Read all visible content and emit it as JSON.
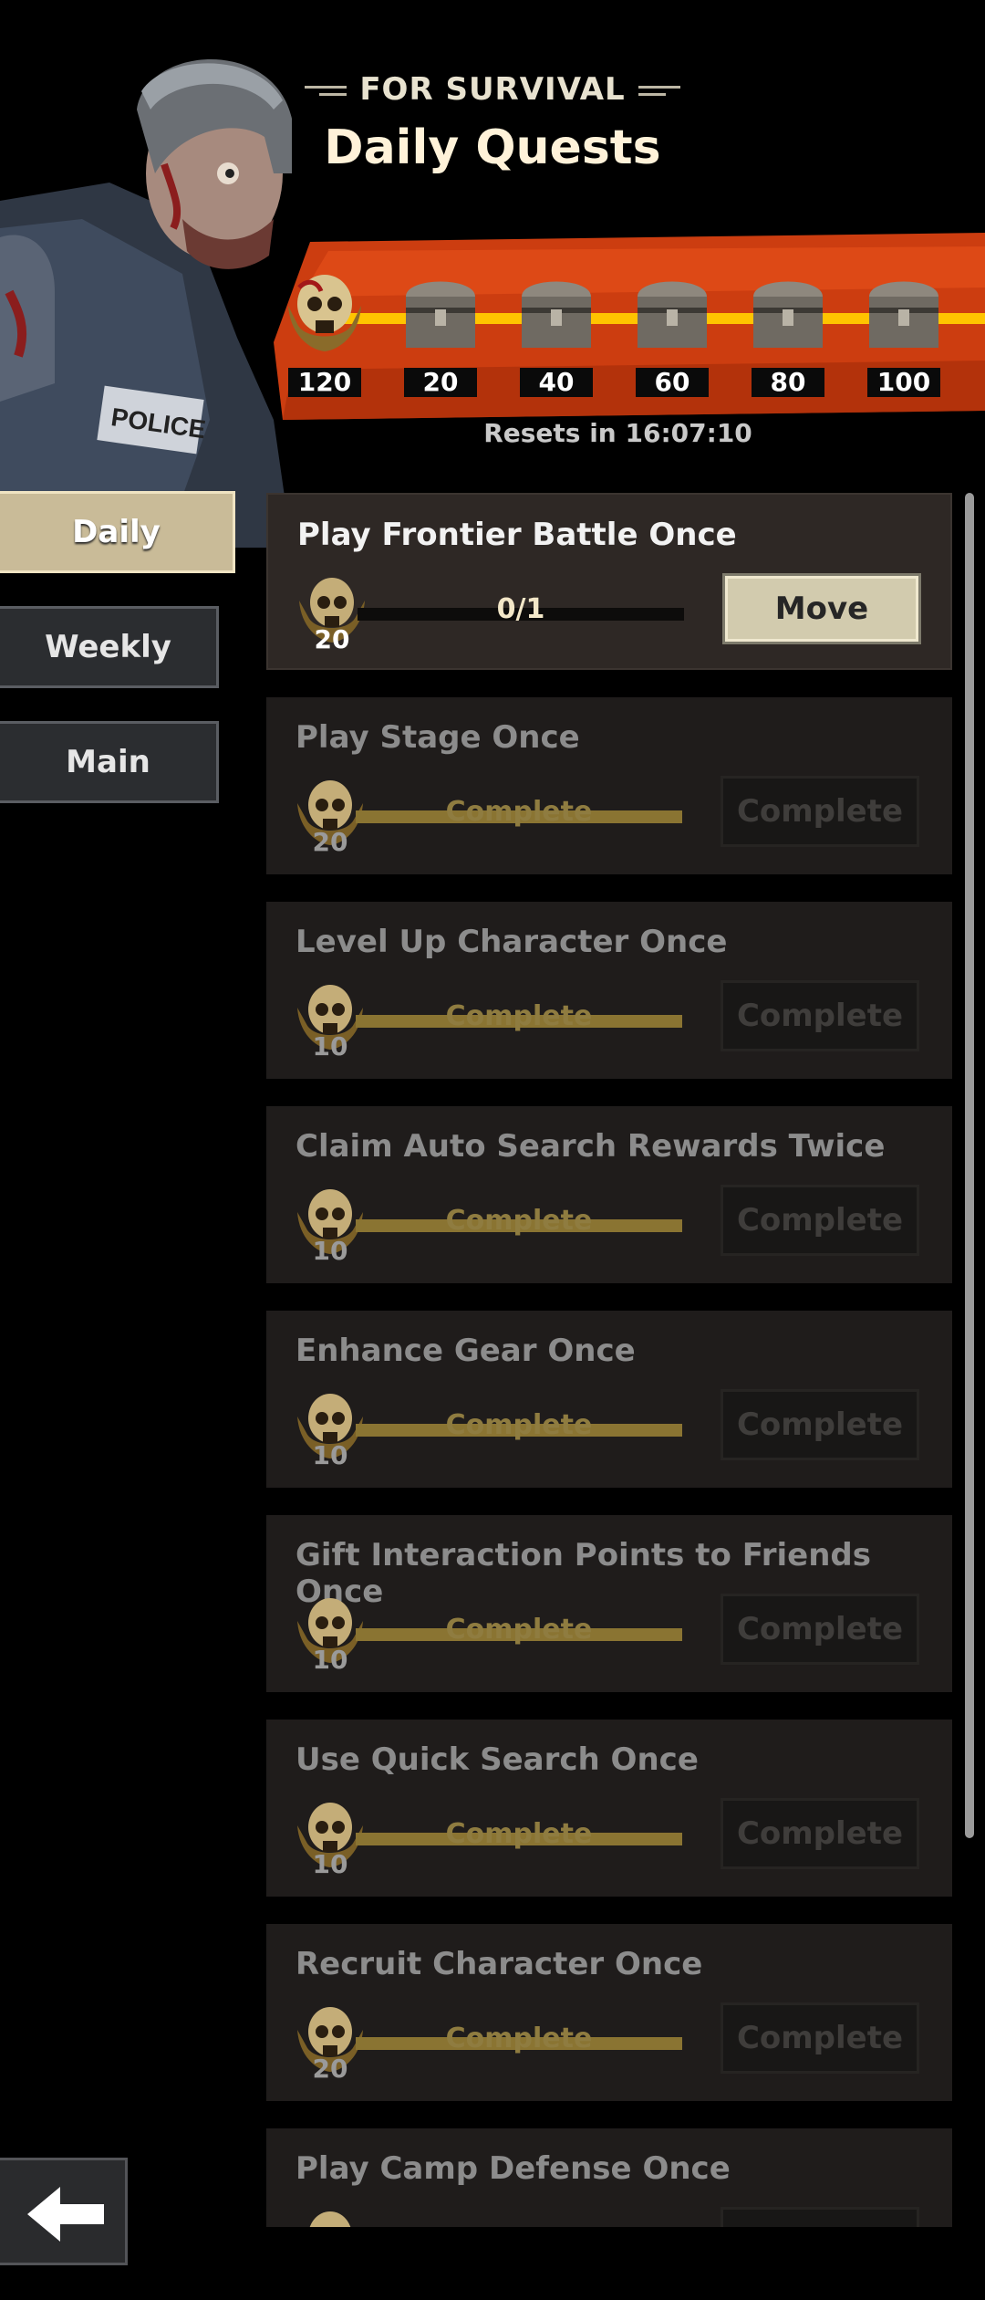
{
  "header": {
    "subtitle": "FOR SURVIVAL",
    "title": "Daily Quests"
  },
  "reward_track": {
    "current_points": "120",
    "milestones": [
      "20",
      "40",
      "60",
      "80",
      "100"
    ],
    "resets": "Resets in 16:07:10",
    "accent_color": "#ffc400",
    "banner_color": "#d9400f"
  },
  "tabs": [
    {
      "label": "Daily",
      "active": true
    },
    {
      "label": "Weekly",
      "active": false
    },
    {
      "label": "Main",
      "active": false
    }
  ],
  "quests": [
    {
      "title": "Play Frontier Battle Once",
      "points": "20",
      "progress": "0/1",
      "button": "Move",
      "state": "active",
      "fill": 0
    },
    {
      "title": "Play Stage Once",
      "points": "20",
      "progress": "Complete",
      "button": "Complete",
      "state": "done",
      "fill": 1
    },
    {
      "title": "Level Up Character Once",
      "points": "10",
      "progress": "Complete",
      "button": "Complete",
      "state": "done",
      "fill": 1
    },
    {
      "title": "Claim Auto Search Rewards Twice",
      "points": "10",
      "progress": "Complete",
      "button": "Complete",
      "state": "done",
      "fill": 1
    },
    {
      "title": "Enhance Gear Once",
      "points": "10",
      "progress": "Complete",
      "button": "Complete",
      "state": "done",
      "fill": 1
    },
    {
      "title": "Gift Interaction Points to Friends Once",
      "points": "10",
      "progress": "Complete",
      "button": "Complete",
      "state": "done",
      "fill": 1
    },
    {
      "title": "Use Quick Search Once",
      "points": "10",
      "progress": "Complete",
      "button": "Complete",
      "state": "done",
      "fill": 1
    },
    {
      "title": "Recruit Character Once",
      "points": "20",
      "progress": "Complete",
      "button": "Complete",
      "state": "done",
      "fill": 1
    },
    {
      "title": "Play Camp Defense Once",
      "points": "",
      "progress": "",
      "button": "",
      "state": "done",
      "fill": 1
    }
  ],
  "icons": {
    "back": "back-arrow-icon",
    "skull": "skull-medal-icon",
    "chest": "treasure-chest-icon",
    "hero": "zombie-police-portrait"
  }
}
